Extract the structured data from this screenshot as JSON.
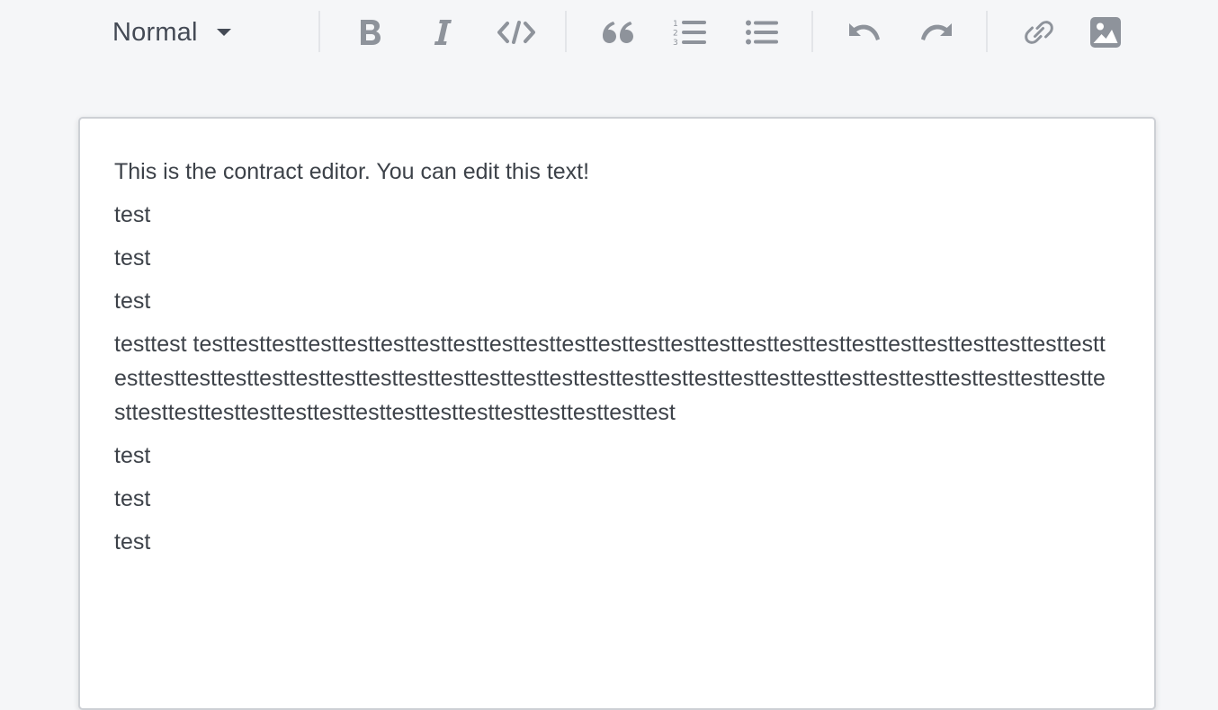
{
  "toolbar": {
    "block_format": "Normal",
    "buttons": [
      {
        "id": "bold",
        "icon": "bold-icon"
      },
      {
        "id": "italic",
        "icon": "italic-icon"
      },
      {
        "id": "code",
        "icon": "code-icon"
      },
      {
        "id": "blockquote",
        "icon": "quote-icon"
      },
      {
        "id": "ordered-list",
        "icon": "ordered-list-icon"
      },
      {
        "id": "bullet-list",
        "icon": "bullet-list-icon"
      },
      {
        "id": "undo",
        "icon": "undo-icon"
      },
      {
        "id": "redo",
        "icon": "redo-icon"
      },
      {
        "id": "link",
        "icon": "link-icon"
      },
      {
        "id": "image",
        "icon": "image-icon"
      }
    ],
    "icon_color": "#8e939b"
  },
  "editor": {
    "paragraphs": [
      "This is the contract editor. You can edit this text!",
      "test",
      "test",
      "test",
      "testtest testtesttesttesttesttesttesttesttesttesttesttesttesttesttesttesttesttesttesttesttesttesttesttesttesttesttesttesttesttesttesttesttesttesttesttesttesttesttesttesttesttesttesttesttesttesttesttesttesttesttesttesttesttesttesttesttesttesttesttesttesttesttesttesttesttesttesttest",
      "test",
      "test",
      "test"
    ]
  }
}
